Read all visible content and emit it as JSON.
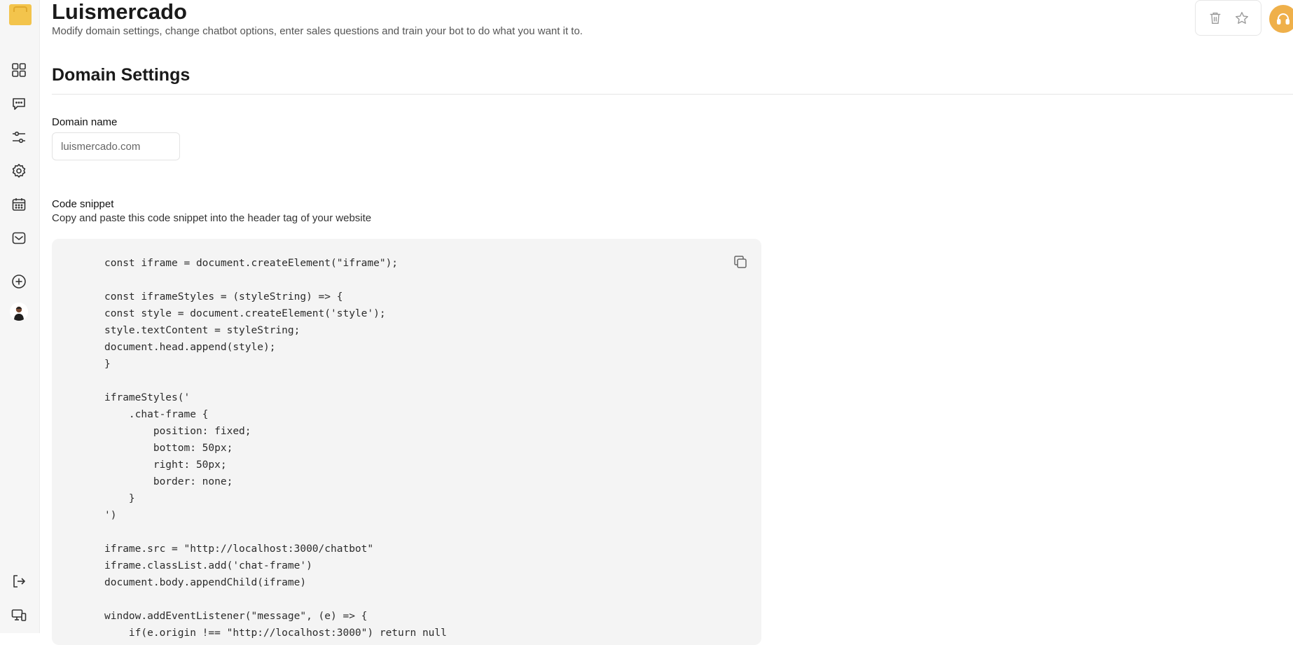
{
  "header": {
    "title": "Luismercado",
    "subtitle": "Modify domain settings, change chatbot options, enter sales questions and train your bot to do what you want it to."
  },
  "sidebar": {
    "items": [
      {
        "icon": "dashboard-grid-icon"
      },
      {
        "icon": "chat-bubble-icon"
      },
      {
        "icon": "sliders-icon"
      },
      {
        "icon": "gear-icon"
      },
      {
        "icon": "calendar-icon"
      },
      {
        "icon": "mail-icon"
      },
      {
        "icon": "plus-circle-icon"
      },
      {
        "icon": "avatar"
      },
      {
        "icon": "logout-icon"
      },
      {
        "icon": "devices-icon"
      }
    ]
  },
  "topbar": {
    "actions": [
      "trash-icon",
      "star-icon"
    ],
    "support": "headset-icon"
  },
  "domain_settings": {
    "section_title": "Domain Settings",
    "domain_name_label": "Domain name",
    "domain_name_value": "luismercado.com",
    "code_snippet_label": "Code snippet",
    "code_snippet_help": "Copy and paste this code snippet into the header tag of your website",
    "code": "const iframe = document.createElement(\"iframe\");\n\nconst iframeStyles = (styleString) => {\nconst style = document.createElement('style');\nstyle.textContent = styleString;\ndocument.head.append(style);\n}\n\niframeStyles('\n    .chat-frame {\n        position: fixed;\n        bottom: 50px;\n        right: 50px;\n        border: none;\n    }\n')\n\niframe.src = \"http://localhost:3000/chatbot\"\niframe.classList.add('chat-frame')\ndocument.body.appendChild(iframe)\n\nwindow.addEventListener(\"message\", (e) => {\n    if(e.origin !== \"http://localhost:3000\") return null"
  },
  "colors": {
    "brand": "#f3c44c",
    "support_button": "#efb04a",
    "code_background": "#f4f4f4"
  }
}
